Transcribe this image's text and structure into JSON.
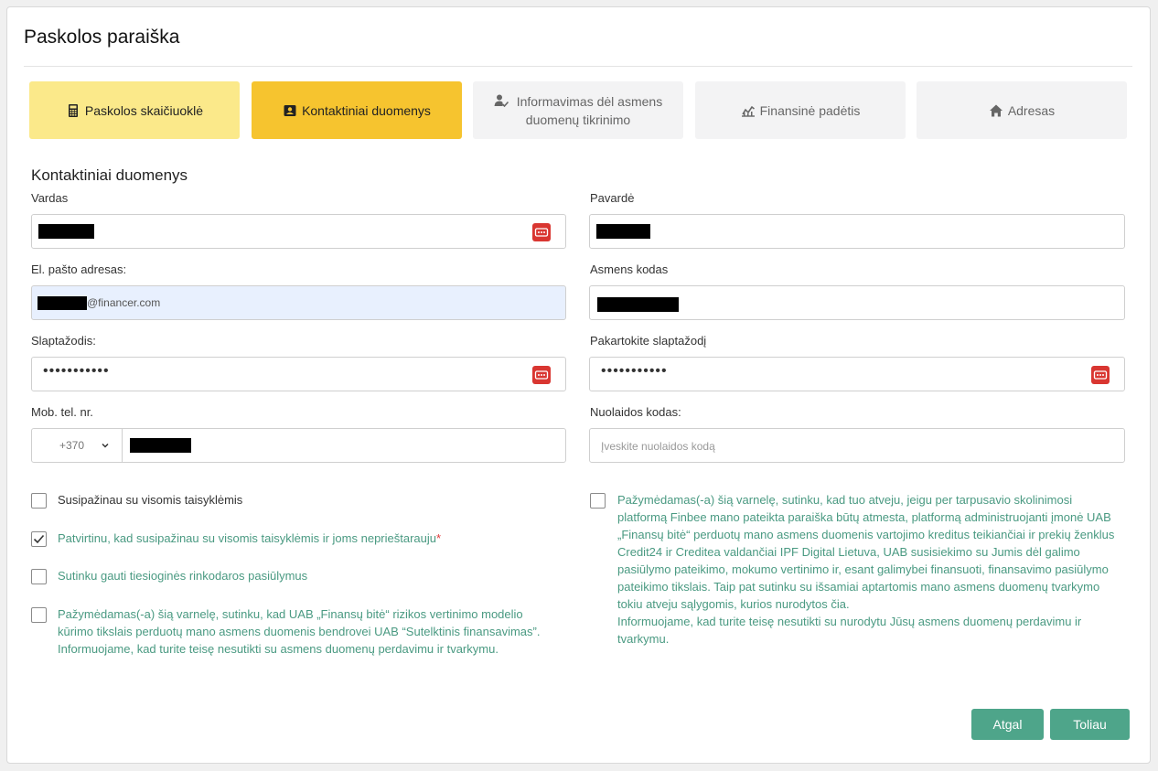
{
  "page": {
    "title": "Paskolos paraiška"
  },
  "steps": [
    {
      "label": "Paskolos skaičiuoklė",
      "icon": "calculator-icon",
      "state": "done"
    },
    {
      "label": "Kontaktiniai duomenys",
      "icon": "contact-card-icon",
      "state": "active"
    },
    {
      "label_line1": "Informavimas dėl asmens",
      "label_line2": "duomenų tikrinimo",
      "icon": "user-check-icon",
      "state": "todo"
    },
    {
      "label": "Finansinė padėtis",
      "icon": "finance-chart-icon",
      "state": "todo"
    },
    {
      "label": "Adresas",
      "icon": "home-icon",
      "state": "todo"
    }
  ],
  "section": {
    "title": "Kontaktiniai duomenys"
  },
  "form": {
    "first_name": {
      "label": "Vardas"
    },
    "last_name": {
      "label": "Pavardė"
    },
    "email": {
      "label": "El. pašto adresas:",
      "domain": "@financer.com"
    },
    "personal_code": {
      "label": "Asmens kodas"
    },
    "password": {
      "label": "Slaptažodis:",
      "masked": "•••••••••••"
    },
    "password_repeat": {
      "label": "Pakartokite slaptažodį",
      "masked": "•••••••••••"
    },
    "phone": {
      "label": "Mob. tel. nr.",
      "prefix": "+370"
    },
    "discount": {
      "label": "Nuolaidos kodas:",
      "placeholder": "Įveskite nuolaidos kodą"
    }
  },
  "consents": {
    "rules_ack": {
      "text": "Susipažinau su visomis taisyklėmis",
      "checked": false
    },
    "rules_confirm": {
      "text": "Patvirtinu, kad susipažinau su visomis taisyklėmis ir joms neprieštarauju",
      "required_mark": "*",
      "checked": true
    },
    "marketing": {
      "text": "Sutinku gauti tiesioginės rinkodaros pasiūlymus",
      "checked": false
    },
    "risk_model": {
      "line1": "Pažymėdamas(-a) šią varnelę, sutinku, kad UAB „Finansų bitė“ rizikos vertinimo modelio",
      "line2": "kūrimo tikslais perduotų mano asmens duomenis bendrovei UAB “Sutelktinis finansavimas”.",
      "line3": "Informuojame, kad turite teisę nesutikti su asmens duomenų perdavimu ir tvarkymu.",
      "checked": false
    },
    "finbee": {
      "line1": "Pažymėdamas(-a) šią varnelę, sutinku, kad tuo atveju, jeigu per tarpusavio skolinimosi",
      "line2": "platformą Finbee mano pateikta paraiška būtų atmesta, platformą administruojanti įmonė UAB",
      "line3": "„Finansų bitė“ perduotų mano asmens duomenis vartojimo kreditus teikiančiai ir prekių ženklus",
      "line4": "Credit24 ir Creditea valdančiai IPF Digital Lietuva, UAB susisiekimo su Jumis dėl galimo",
      "line5": "pasiūlymo pateikimo, mokumo vertinimo ir, esant galimybei finansuoti, finansavimo pasiūlymo",
      "line6": "pateikimo tikslais. Taip pat sutinku su išsamiai aptartomis mano asmens duomenų tvarkymo",
      "line7": "tokiu atveju sąlygomis, kurios nurodytos čia.",
      "line8": "Informuojame, kad turite teisę nesutikti su nurodytu Jūsų asmens duomenų perdavimu ir",
      "line9": "tvarkymu.",
      "checked": false
    }
  },
  "buttons": {
    "back": "Atgal",
    "next": "Toliau"
  },
  "colors": {
    "accent": "#4ea58a",
    "active_step": "#f6c42f",
    "done_step": "#fbe98a",
    "key_icon": "#d93631"
  }
}
